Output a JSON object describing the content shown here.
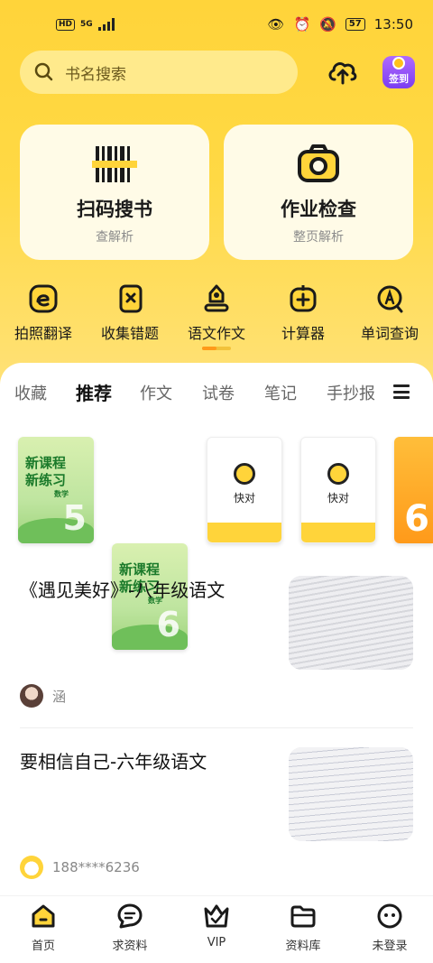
{
  "status_bar": {
    "network": "HD",
    "signal": "5G",
    "time": "13:50",
    "battery": "57"
  },
  "search": {
    "placeholder": "书名搜索"
  },
  "cards": [
    {
      "title": "扫码搜书",
      "subtitle": "查解析",
      "icon": "barcode-icon"
    },
    {
      "title": "作业检查",
      "subtitle": "整页解析",
      "icon": "camera-icon"
    }
  ],
  "sign_in": {
    "label": "签到"
  },
  "tools": [
    {
      "label": "拍照翻译",
      "icon": "translate-icon"
    },
    {
      "label": "收集错题",
      "icon": "mistake-icon"
    },
    {
      "label": "语文作文",
      "icon": "essay-icon"
    },
    {
      "label": "计算器",
      "icon": "calculator-icon"
    },
    {
      "label": "单词查询",
      "icon": "word-lookup-icon"
    }
  ],
  "tabs": [
    "收藏",
    "推荐",
    "作文",
    "试卷",
    "笔记",
    "手抄报"
  ],
  "active_tab": "推荐",
  "books": [
    {
      "type": "cover",
      "title1": "新课程",
      "title2": "新练习",
      "subject": "数学",
      "number": "5"
    },
    {
      "type": "cover",
      "title1": "新课程",
      "title2": "新练习",
      "subject": "数学",
      "number": "6"
    },
    {
      "type": "kuaidui",
      "label": "快对"
    },
    {
      "type": "kuaidui",
      "label": "快对"
    },
    {
      "type": "orange",
      "number": "6"
    }
  ],
  "articles": [
    {
      "title": "《遇见美好》-八年级语文",
      "author": "涵"
    },
    {
      "title": "要相信自己-六年级语文",
      "author": "188****6236"
    }
  ],
  "bottom_nav": [
    "首页",
    "求资料",
    "VIP",
    "资料库",
    "未登录"
  ],
  "colors": {
    "accent": "#ffd43a",
    "card_bg": "#fffbe7",
    "search_bg": "#ffea8c"
  }
}
